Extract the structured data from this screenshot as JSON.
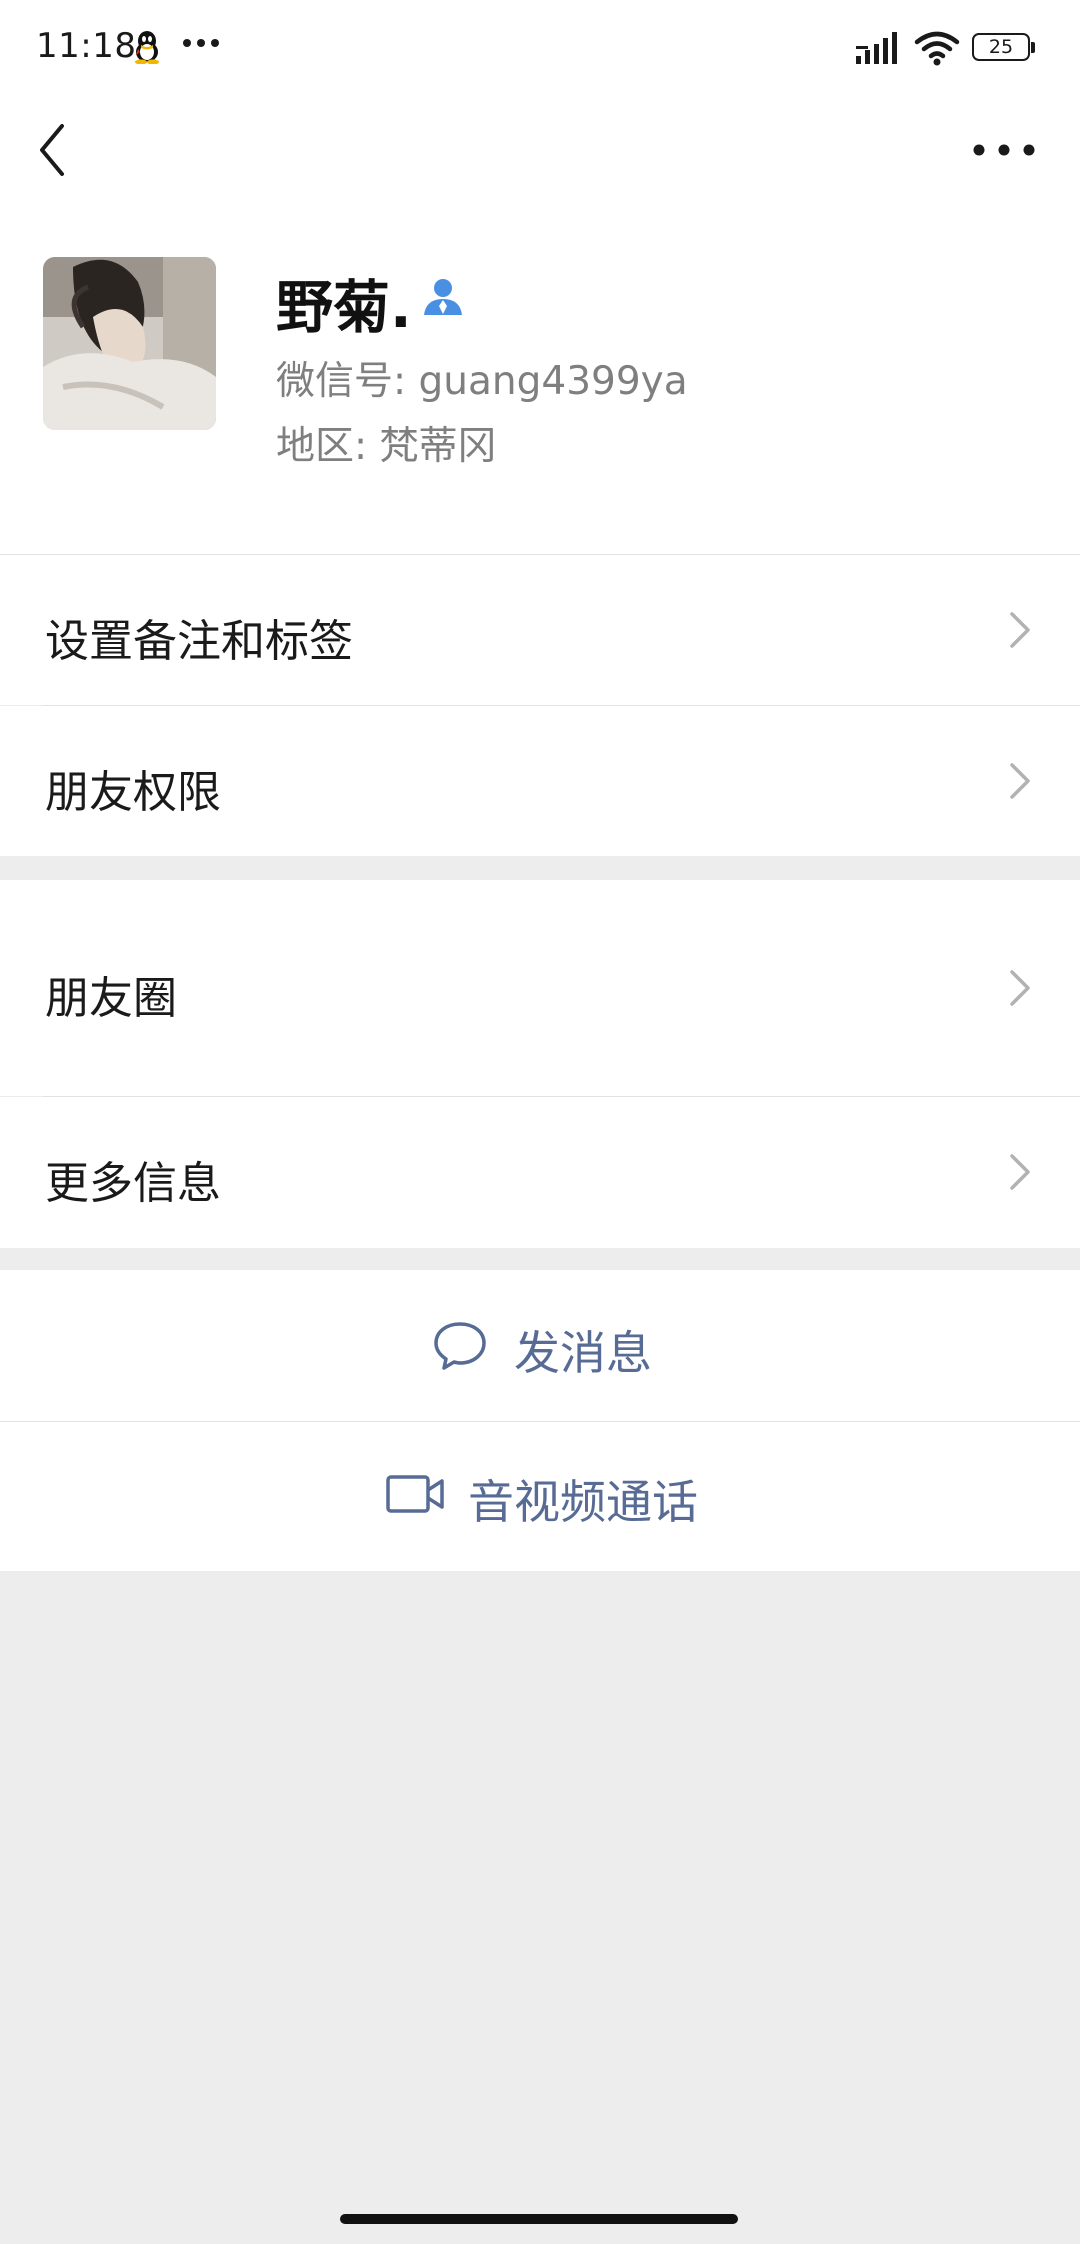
{
  "status_bar": {
    "time": "11:18",
    "battery_level": "25",
    "icons": [
      "qq-icon",
      "more-dots-icon",
      "signal-icon",
      "wifi-icon",
      "battery-icon"
    ]
  },
  "nav": {
    "back_icon": "chevron-left-icon",
    "more_icon": "ellipsis-icon"
  },
  "profile": {
    "name": "野菊.",
    "wechat_id_label": "微信号:",
    "wechat_id": "guang4399ya",
    "region_label": "地区:",
    "region": "梵蒂冈",
    "badge_icon": "contact-person-icon"
  },
  "menu": {
    "remarks_tags": "设置备注和标签",
    "friend_permissions": "朋友权限",
    "moments": "朋友圈",
    "more_info": "更多信息"
  },
  "actions": {
    "send_message": "发消息",
    "video_call": "音视频通话"
  },
  "colors": {
    "link": "#576b95",
    "background": "#ededed",
    "badge": "#4a90e2"
  }
}
